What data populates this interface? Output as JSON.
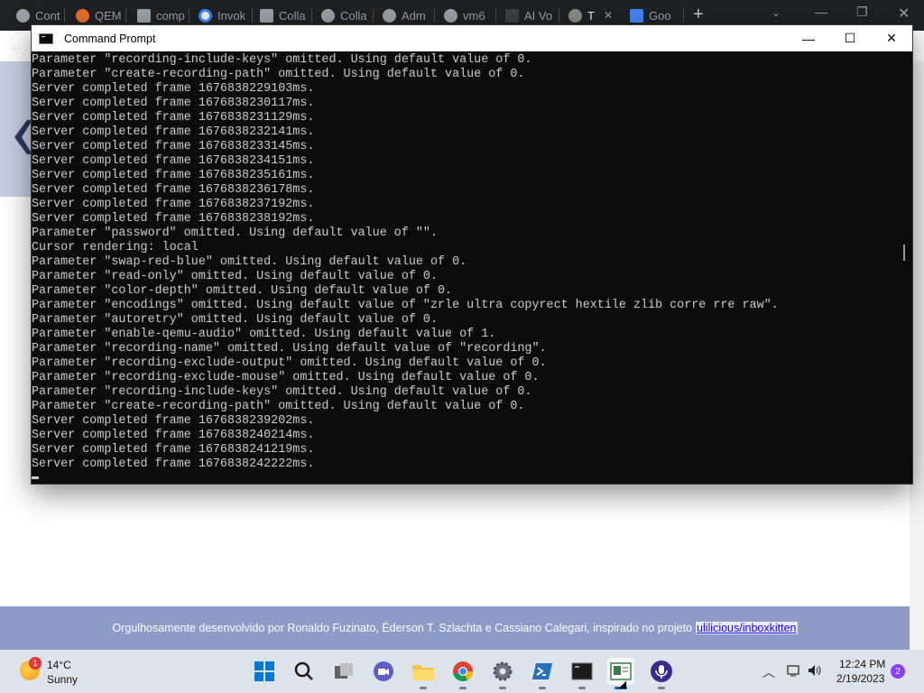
{
  "browser": {
    "tabs": [
      {
        "label": "Cont",
        "icon": "globe-icon",
        "color": "#9aa0a6"
      },
      {
        "label": "QEM",
        "icon": "qemu-icon",
        "color": "#e8702a"
      },
      {
        "label": "comp",
        "icon": "stack-icon",
        "color": "#9aa0a6"
      },
      {
        "label": "Invok",
        "icon": "google-icon",
        "color": "#4285f4"
      },
      {
        "label": "Colla",
        "icon": "stack-icon",
        "color": "#9aa0a6"
      },
      {
        "label": "Colla",
        "icon": "globe-icon",
        "color": "#9aa0a6"
      },
      {
        "label": "Adm",
        "icon": "globe-icon",
        "color": "#9aa0a6"
      },
      {
        "label": "vm6",
        "icon": "globe-icon",
        "color": "#9aa0a6"
      },
      {
        "label": "AI Vo",
        "icon": "square-logo-icon",
        "color": "#5f6368"
      },
      {
        "label": "T",
        "icon": "avatar-icon",
        "color": "#8a8a8a"
      },
      {
        "label": "Goo",
        "icon": "google-translate-icon",
        "color": "#4285f4"
      }
    ],
    "new_tab": "+",
    "controls": {
      "minimize": "—",
      "maximize": "❐",
      "close": "✕"
    }
  },
  "page": {
    "footer_text": "Orgulhosamente desenvolvido por Ronaldo Fuzinato, Éderson T. Szlachta e Cassiano Calegari, inspirado no projeto",
    "footer_link": "ulilicious/inboxkitten",
    "banner_color": "#c5cfe2",
    "footer_color": "#8c9cc7"
  },
  "cmd": {
    "title": "Command Prompt",
    "controls": {
      "minimize": "—",
      "maximize": "☐",
      "close": "✕"
    },
    "lines": [
      "Parameter \"recording-include-keys\" omitted. Using default value of 0.",
      "Parameter \"create-recording-path\" omitted. Using default value of 0.",
      "Server completed frame 1676838229103ms.",
      "Server completed frame 1676838230117ms.",
      "Server completed frame 1676838231129ms.",
      "Server completed frame 1676838232141ms.",
      "Server completed frame 1676838233145ms.",
      "Server completed frame 1676838234151ms.",
      "Server completed frame 1676838235161ms.",
      "Server completed frame 1676838236178ms.",
      "Server completed frame 1676838237192ms.",
      "Server completed frame 1676838238192ms.",
      "Parameter \"password\" omitted. Using default value of \"\".",
      "Cursor rendering: local",
      "Parameter \"swap-red-blue\" omitted. Using default value of 0.",
      "Parameter \"read-only\" omitted. Using default value of 0.",
      "Parameter \"color-depth\" omitted. Using default value of 0.",
      "Parameter \"encodings\" omitted. Using default value of \"zrle ultra copyrect hextile zlib corre rre raw\".",
      "Parameter \"autoretry\" omitted. Using default value of 0.",
      "Parameter \"enable-qemu-audio\" omitted. Using default value of 1.",
      "Parameter \"recording-name\" omitted. Using default value of \"recording\".",
      "Parameter \"recording-exclude-output\" omitted. Using default value of 0.",
      "Parameter \"recording-exclude-mouse\" omitted. Using default value of 0.",
      "Parameter \"recording-include-keys\" omitted. Using default value of 0.",
      "Parameter \"create-recording-path\" omitted. Using default value of 0.",
      "Server completed frame 1676838239202ms.",
      "Server completed frame 1676838240214ms.",
      "Server completed frame 1676838241219ms.",
      "Server completed frame 1676838242222ms."
    ]
  },
  "taskbar": {
    "weather": {
      "temp": "14°C",
      "condition": "Sunny",
      "badge": "1"
    },
    "apps": [
      {
        "name": "start-button",
        "icon": "windows-logo-icon"
      },
      {
        "name": "search-button",
        "icon": "search-icon"
      },
      {
        "name": "task-view-button",
        "icon": "task-view-icon"
      },
      {
        "name": "teams-chat-button",
        "icon": "video-chat-icon"
      },
      {
        "name": "file-explorer-button",
        "icon": "folder-icon"
      },
      {
        "name": "chrome-button",
        "icon": "chrome-icon"
      },
      {
        "name": "settings-button",
        "icon": "gear-icon"
      },
      {
        "name": "powershell-button",
        "icon": "powershell-icon"
      },
      {
        "name": "terminal-button",
        "icon": "terminal-icon"
      },
      {
        "name": "editor-button",
        "icon": "document-icon"
      },
      {
        "name": "podcast-app-button",
        "icon": "microphone-icon"
      }
    ],
    "clock": {
      "time": "12:24 PM",
      "date": "2/19/2023"
    },
    "notifications": "2"
  }
}
